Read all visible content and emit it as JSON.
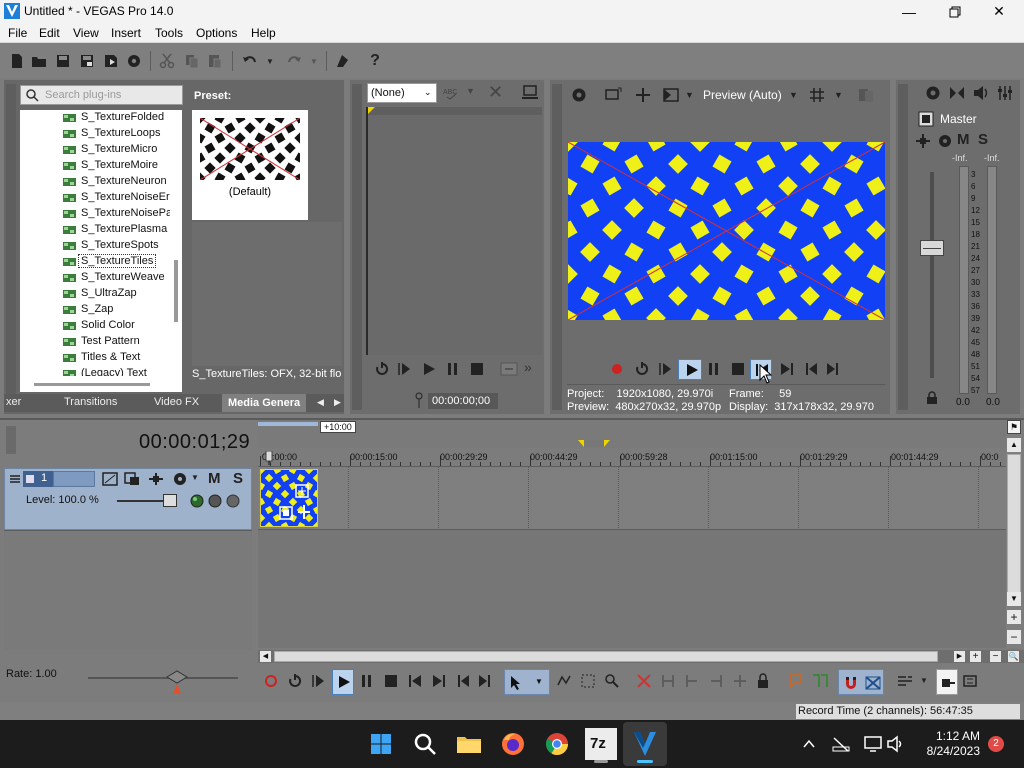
{
  "window": {
    "title": "Untitled * - VEGAS Pro 14.0",
    "controls": [
      "minimize-icon",
      "maximize-icon",
      "close-icon"
    ]
  },
  "menu": [
    "File",
    "Edit",
    "View",
    "Insert",
    "Tools",
    "Options",
    "Help"
  ],
  "explorer": {
    "search_placeholder": "Search plug-ins",
    "preset_label": "Preset:",
    "preset_name": "(Default)",
    "items": [
      "S_TextureFolded",
      "S_TextureLoops",
      "S_TextureMicro",
      "S_TextureMoire",
      "S_TextureNeuron",
      "S_TextureNoiseEr",
      "S_TextureNoisePa",
      "S_TexturePlasma",
      "S_TextureSpots",
      "S_TextureTiles",
      "S_TextureWeave",
      "S_UltraZap",
      "S_Zap",
      "Solid Color",
      "Test Pattern",
      "Titles & Text",
      "(Legacy) Text"
    ],
    "selected_item": "S_TextureTiles",
    "status": "S_TextureTiles: OFX, 32-bit flo",
    "tabs": [
      "xer",
      "Transitions",
      "Video FX",
      "Media Genera"
    ],
    "active_tab": "Media Genera"
  },
  "trimmer": {
    "select_value": "(None)",
    "timecode": "00:00:00;00"
  },
  "preview": {
    "mode": "Preview (Auto)",
    "project_label": "Project:",
    "project_value": "1920x1080, 29.970i",
    "preview_label": "Preview:",
    "preview_value": "480x270x32, 29.970p",
    "frame_label": "Frame:",
    "frame_value": "59",
    "display_label": "Display:",
    "display_value": "317x178x32, 29.970"
  },
  "master": {
    "label": "Master",
    "db_left": "-Inf.",
    "db_right": "-Inf.",
    "scale": [
      "3",
      "6",
      "9",
      "12",
      "15",
      "18",
      "21",
      "24",
      "27",
      "30",
      "33",
      "36",
      "39",
      "42",
      "45",
      "48",
      "51",
      "54",
      "57"
    ],
    "bottom_left": "0.0",
    "bottom_right": "0.0",
    "m_label": "M",
    "s_label": "S"
  },
  "timeline": {
    "timecode": "00:00:01;29",
    "region_marker": "+10:00",
    "track_number": "1",
    "track_level": "Level: 100.0 %",
    "m_label": "M",
    "s_label": "S",
    "ruler": [
      "00:00:00",
      "00:00:15:00",
      "00:00:29:29",
      "00:00:44:29",
      "00:00:59:28",
      "00:01:15:00",
      "00:01:29:29",
      "00:01:44:29",
      "00:0"
    ],
    "rate": "Rate: 1.00"
  },
  "status": {
    "record_time": "Record Time (2 channels): 56:47:35"
  },
  "taskbar": {
    "apps": [
      "windows-start-icon",
      "search-icon",
      "file-explorer-icon",
      "firefox-icon",
      "chrome-icon",
      "7zip-icon",
      "vegas-icon"
    ],
    "time": "1:12 AM",
    "date": "8/24/2023",
    "notifications": "2",
    "seven_zip_label": "7z"
  },
  "colors": {
    "preview_bg": "#1240f5",
    "preview_tile": "#eef018",
    "track_header": "#9eb2cc"
  }
}
